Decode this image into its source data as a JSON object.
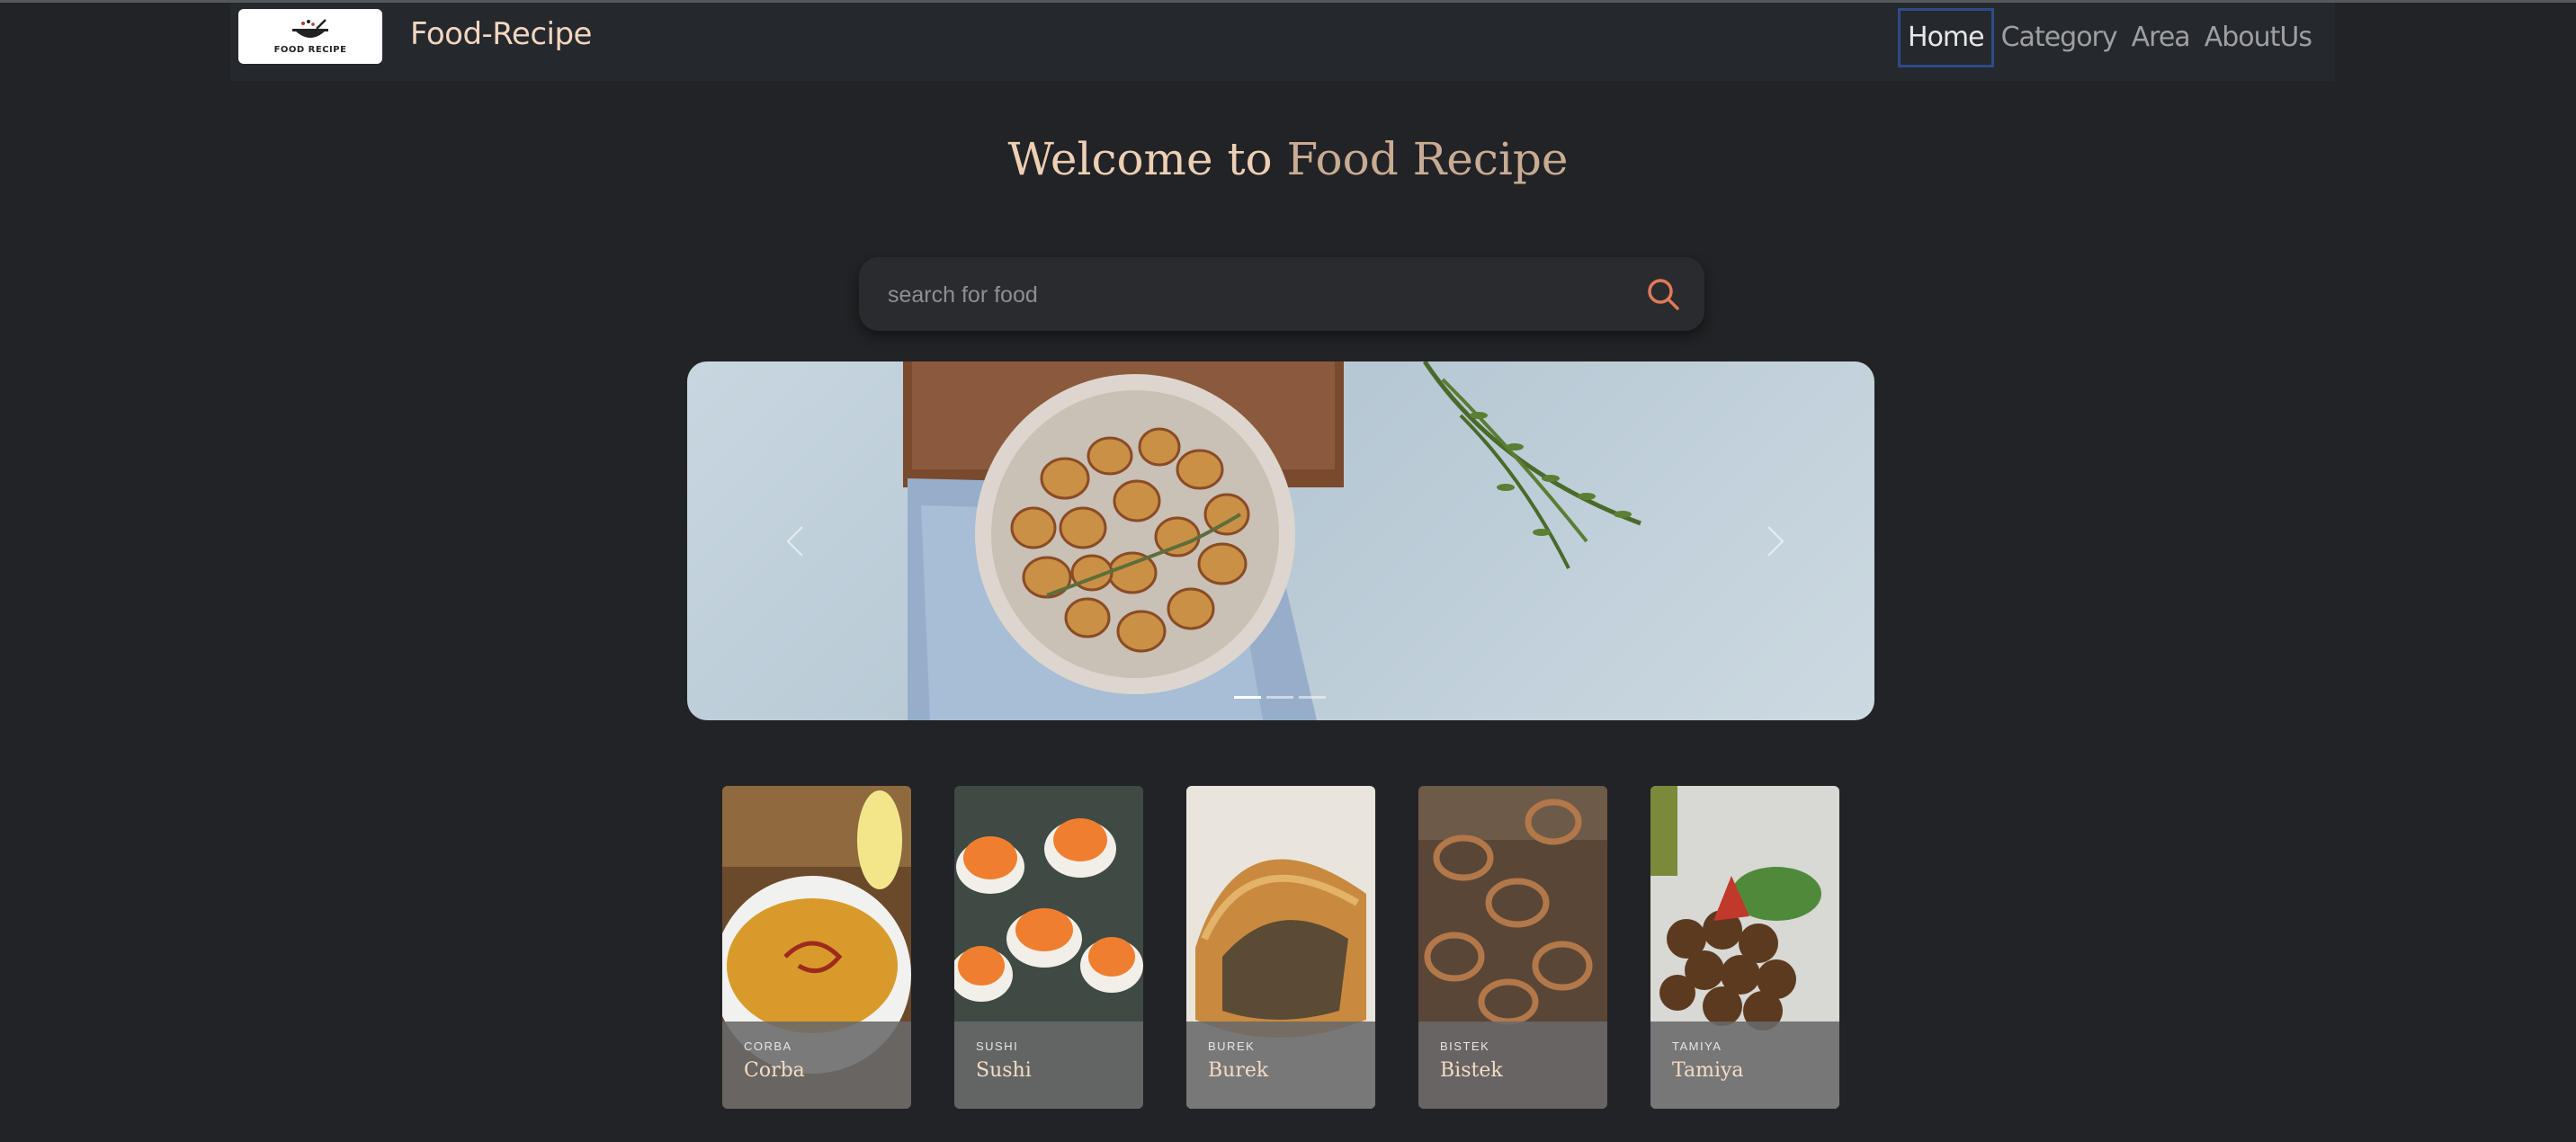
{
  "header": {
    "logo_text": "FOOD RECIPE",
    "brand": "Food-Recipe",
    "nav": [
      {
        "label": "Home",
        "active": true
      },
      {
        "label": "Category",
        "active": false
      },
      {
        "label": "Area",
        "active": false
      },
      {
        "label": "AboutUs",
        "active": false
      }
    ]
  },
  "hero": {
    "title_part1": "Welcome to ",
    "title_part2": "Food Recipe"
  },
  "search": {
    "placeholder": "search for food",
    "icon": "search-icon"
  },
  "carousel": {
    "slide_count": 3,
    "active_index": 0,
    "prev_icon": "chevron-left-icon",
    "next_icon": "chevron-right-icon"
  },
  "cards": [
    {
      "category": "CORBA",
      "title": "Corba"
    },
    {
      "category": "SUSHI",
      "title": "Sushi"
    },
    {
      "category": "BUREK",
      "title": "Burek"
    },
    {
      "category": "BISTEK",
      "title": "Bistek"
    },
    {
      "category": "TAMIYA",
      "title": "Tamiya"
    }
  ],
  "colors": {
    "background": "#222326",
    "navbar": "#25282d",
    "accent": "#edcfb4",
    "search_icon": "#e07a56",
    "active_nav_border": "#2d4b8a"
  }
}
